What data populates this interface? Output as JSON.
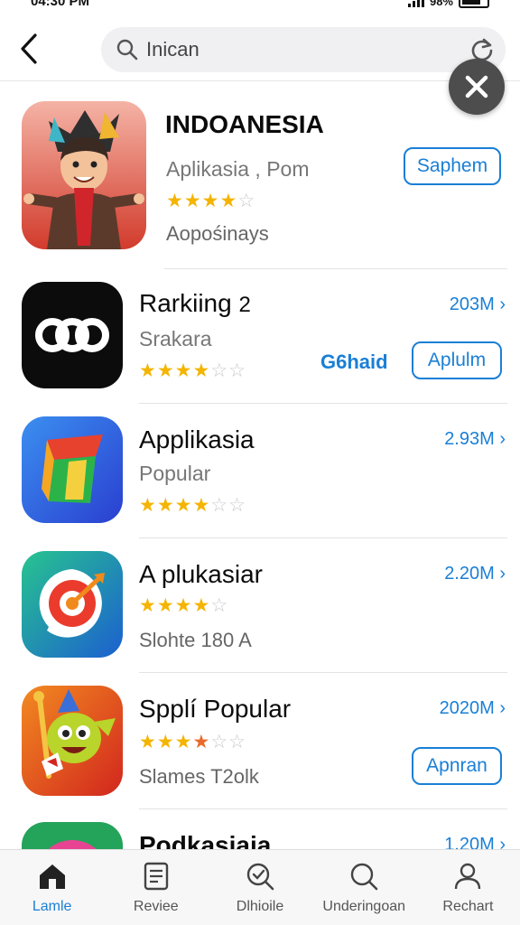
{
  "status": {
    "time": "04:30 PM",
    "battery": "98%"
  },
  "search": {
    "value": "Inican"
  },
  "apps": [
    {
      "name": "INDOANESIA",
      "subtitle": "Aplikasia , Pom",
      "extra": "Aopośinays",
      "rating": 4,
      "button": "Saphem"
    },
    {
      "name": "Rarkiing",
      "rank": "2",
      "subtitle": "Srakara",
      "rating": 4,
      "size": "203M",
      "badge": "G6haid",
      "button": "Aplulm"
    },
    {
      "name": "Applikasia",
      "subtitle": "Popular",
      "rating": 4,
      "size": "2.93M"
    },
    {
      "name": "A plukasiar",
      "extra": "Slohte 180 A",
      "rating": 4,
      "size": "2.20M"
    },
    {
      "name": "Spplí Popular",
      "extra": "Slames T2olk",
      "rating": 3.5,
      "size": "2020M",
      "button": "Apnran"
    },
    {
      "name": "Podkasiaia",
      "size": "1.20M"
    }
  ],
  "tabs": [
    {
      "label": "Lamle",
      "icon": "home-icon"
    },
    {
      "label": "Reviee",
      "icon": "document-icon"
    },
    {
      "label": "Dlhioile",
      "icon": "search-check-icon"
    },
    {
      "label": "Underingoan",
      "icon": "search-icon"
    },
    {
      "label": "Rechart",
      "icon": "person-icon"
    }
  ],
  "colors": {
    "accent": "#1a7fd6",
    "star": "#f4b400"
  }
}
